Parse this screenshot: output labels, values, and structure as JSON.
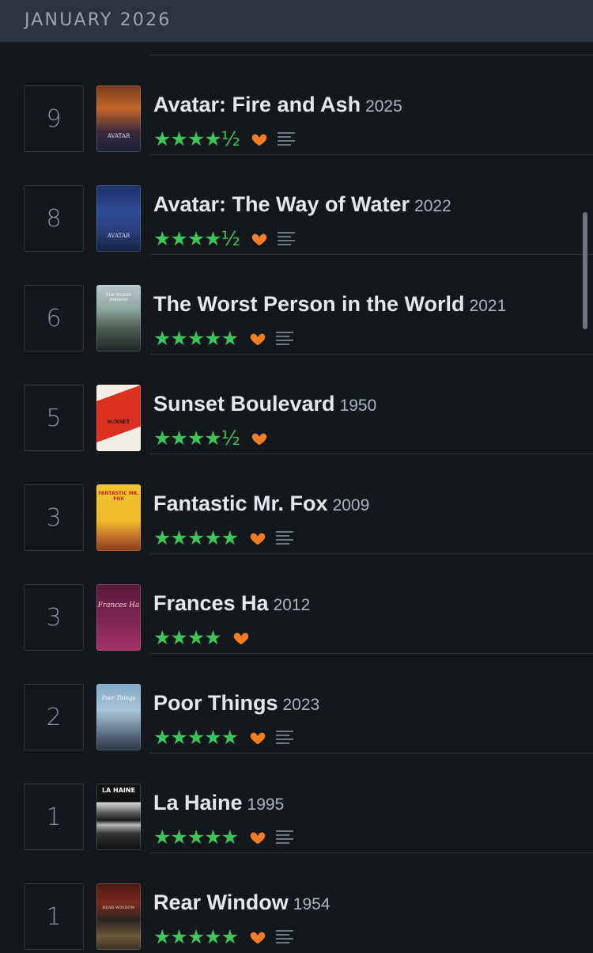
{
  "header": {
    "title": "JANUARY 2026"
  },
  "entries": [
    {
      "day": "9",
      "title": "Avatar: Fire and Ash",
      "year": "2025",
      "stars": "★★★★½",
      "liked": true,
      "has_review": true,
      "poster_icon": "avatar-fire-ash-poster"
    },
    {
      "day": "8",
      "title": "Avatar: The Way of Water",
      "year": "2022",
      "stars": "★★★★½",
      "liked": true,
      "has_review": true,
      "poster_icon": "avatar-way-of-water-poster"
    },
    {
      "day": "6",
      "title": "The Worst Person in the World",
      "year": "2021",
      "stars": "★★★★★",
      "liked": true,
      "has_review": true,
      "poster_icon": "worst-person-poster"
    },
    {
      "day": "5",
      "title": "Sunset Boulevard",
      "year": "1950",
      "stars": "★★★★½",
      "liked": true,
      "has_review": false,
      "poster_icon": "sunset-boulevard-poster"
    },
    {
      "day": "3",
      "title": "Fantastic Mr. Fox",
      "year": "2009",
      "stars": "★★★★★",
      "liked": true,
      "has_review": true,
      "poster_icon": "fantastic-mr-fox-poster"
    },
    {
      "day": "3",
      "title": "Frances Ha",
      "year": "2012",
      "stars": "★★★★",
      "liked": true,
      "has_review": false,
      "poster_icon": "frances-ha-poster"
    },
    {
      "day": "2",
      "title": "Poor Things",
      "year": "2023",
      "stars": "★★★★★",
      "liked": true,
      "has_review": true,
      "poster_icon": "poor-things-poster"
    },
    {
      "day": "1",
      "title": "La Haine",
      "year": "1995",
      "stars": "★★★★★",
      "liked": true,
      "has_review": true,
      "poster_icon": "la-haine-poster"
    },
    {
      "day": "1",
      "title": "Rear Window",
      "year": "1954",
      "stars": "★★★★★",
      "liked": true,
      "has_review": true,
      "poster_icon": "rear-window-poster"
    }
  ],
  "posters": {
    "avatar1_label": "AVATAR",
    "avatar2_label": "AVATAR",
    "worst_label": "THE WORST PERSON",
    "sunset_label": "SUNSET",
    "fox_label": "FANTASTIC MR. FOX",
    "frances_label": "Frances Ha",
    "poor_label": "Poor Things",
    "haine_label": "LA HAINE",
    "rear_label": "REAR WINDOW"
  },
  "colors": {
    "background": "#14181c",
    "header": "#2c3440",
    "star_green": "#40c35a",
    "heart_orange": "#f27d24",
    "review_icon": "#6d7885"
  }
}
